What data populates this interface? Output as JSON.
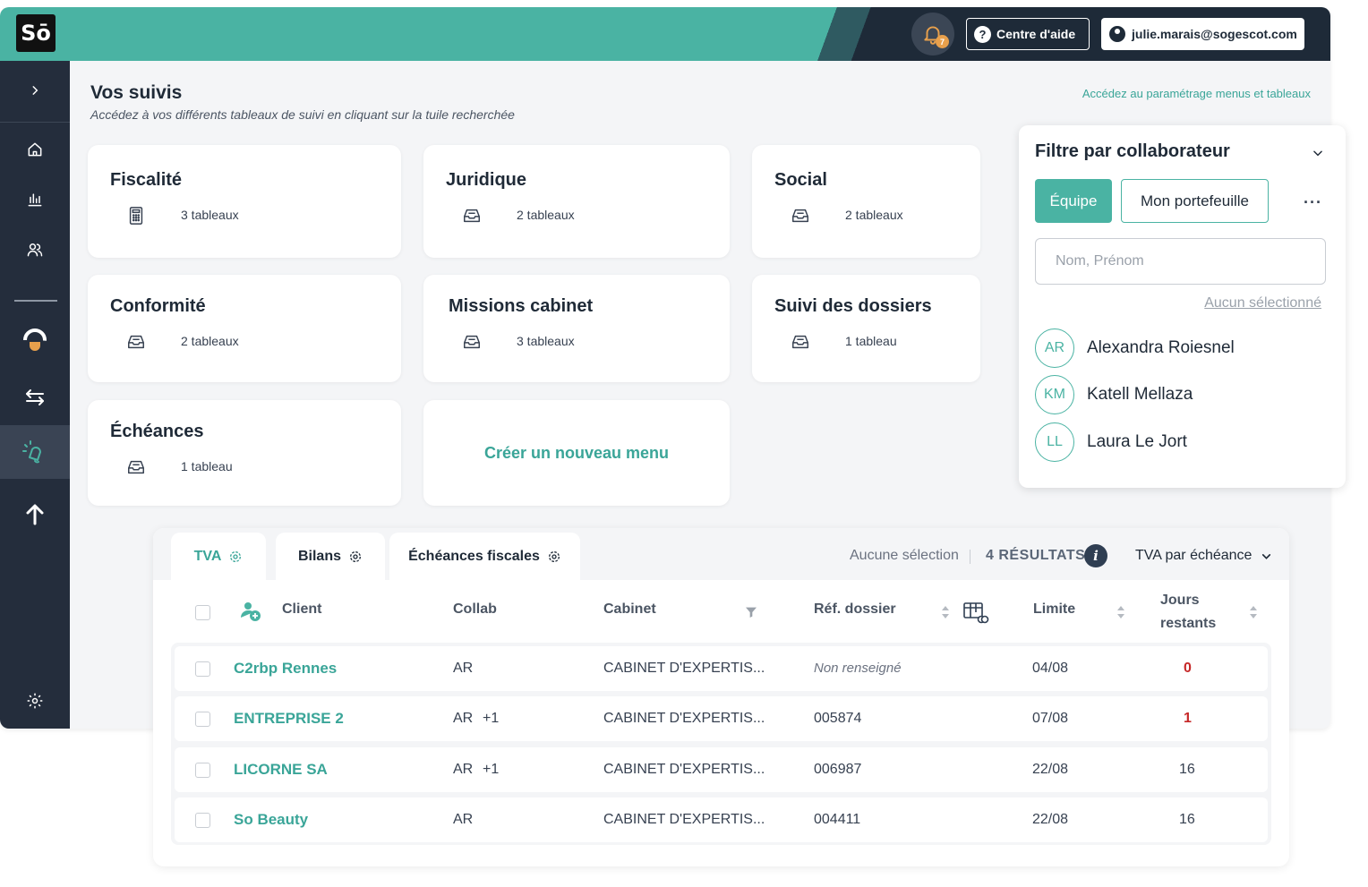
{
  "header": {
    "logo_text": "Sō",
    "notification_count": "7",
    "help_label": "Centre d'aide",
    "user_email": "julie.marais@sogescot.com"
  },
  "sidebar": {
    "items": [
      {
        "icon": "chevron-right-icon"
      },
      {
        "icon": "home-icon"
      },
      {
        "icon": "bar-chart-icon"
      },
      {
        "icon": "users-icon"
      },
      {
        "icon": "half-gauge-icon"
      },
      {
        "icon": "transfer-arrows-icon"
      },
      {
        "icon": "megaphone-bell-icon",
        "active": true
      },
      {
        "icon": "arrow-up-icon"
      },
      {
        "icon": "gear-icon"
      }
    ]
  },
  "page": {
    "title": "Vos suivis",
    "subtitle": "Accédez à vos différents tableaux de suivi en cliquant sur la tuile recherchée",
    "settings_link": "Accédez au paramétrage menus et tableaux"
  },
  "tiles": [
    {
      "title": "Fiscalité",
      "count": "3 tableaux",
      "icon": "calculator-icon"
    },
    {
      "title": "Juridique",
      "count": "2 tableaux",
      "icon": "inbox-tray-icon"
    },
    {
      "title": "Social",
      "count": "2 tableaux",
      "icon": "inbox-tray-icon"
    },
    {
      "title": "Conformité",
      "count": "2 tableaux",
      "icon": "inbox-tray-icon"
    },
    {
      "title": "Missions cabinet",
      "count": "3 tableaux",
      "icon": "inbox-tray-icon"
    },
    {
      "title": "Suivi des dossiers",
      "count": "1 tableau",
      "icon": "inbox-tray-icon"
    },
    {
      "title": "Échéances",
      "count": "1 tableau",
      "icon": "inbox-tray-icon"
    }
  ],
  "create_tile": {
    "label": "Créer un nouveau menu"
  },
  "filter": {
    "title": "Filtre par collaborateur",
    "team_label": "Équipe",
    "portfolio_label": "Mon portefeuille",
    "more_label": "···",
    "search_placeholder": "Nom, Prénom",
    "none_selected": "Aucun sélectionné",
    "collaborators": [
      {
        "initials": "AR",
        "name": "Alexandra Roiesnel"
      },
      {
        "initials": "KM",
        "name": "Katell Mellaza"
      },
      {
        "initials": "LL",
        "name": "Laura Le Jort"
      }
    ]
  },
  "table": {
    "tabs": [
      {
        "label": "TVA",
        "active": true
      },
      {
        "label": "Bilans",
        "active": false
      },
      {
        "label": "Échéances fiscales",
        "active": false
      }
    ],
    "selection_text": "Aucune sélection",
    "results_text": "4 RÉSULTATS",
    "info_icon": "i",
    "view_label": "TVA par échéance",
    "columns": {
      "client": "Client",
      "collab": "Collab",
      "cabinet": "Cabinet",
      "ref": "Réf. dossier",
      "limite": "Limite",
      "jours_line1": "Jours",
      "jours_line2": "restants"
    },
    "rows": [
      {
        "client": "C2rbp Rennes",
        "collab": "AR",
        "collab_extra": "",
        "cabinet": "CABINET D'EXPERTIS...",
        "ref": "Non renseigné",
        "ref_missing": true,
        "limite": "04/08",
        "jours": "0",
        "urgent": true
      },
      {
        "client": "ENTREPRISE 2",
        "collab": "AR",
        "collab_extra": "+1",
        "cabinet": "CABINET D'EXPERTIS...",
        "ref": "005874",
        "ref_missing": false,
        "limite": "07/08",
        "jours": "1",
        "urgent": true
      },
      {
        "client": "LICORNE SA",
        "collab": "AR",
        "collab_extra": "+1",
        "cabinet": "CABINET D'EXPERTIS...",
        "ref": "006987",
        "ref_missing": false,
        "limite": "22/08",
        "jours": "16",
        "urgent": false
      },
      {
        "client": "So Beauty",
        "collab": "AR",
        "collab_extra": "",
        "cabinet": "CABINET D'EXPERTIS...",
        "ref": "004411",
        "ref_missing": false,
        "limite": "22/08",
        "jours": "16",
        "urgent": false
      }
    ]
  },
  "colors": {
    "teal": "#4ab3a3",
    "navy": "#1e2a38",
    "sidebar": "#242d3c",
    "urgent_red": "#c62828"
  }
}
